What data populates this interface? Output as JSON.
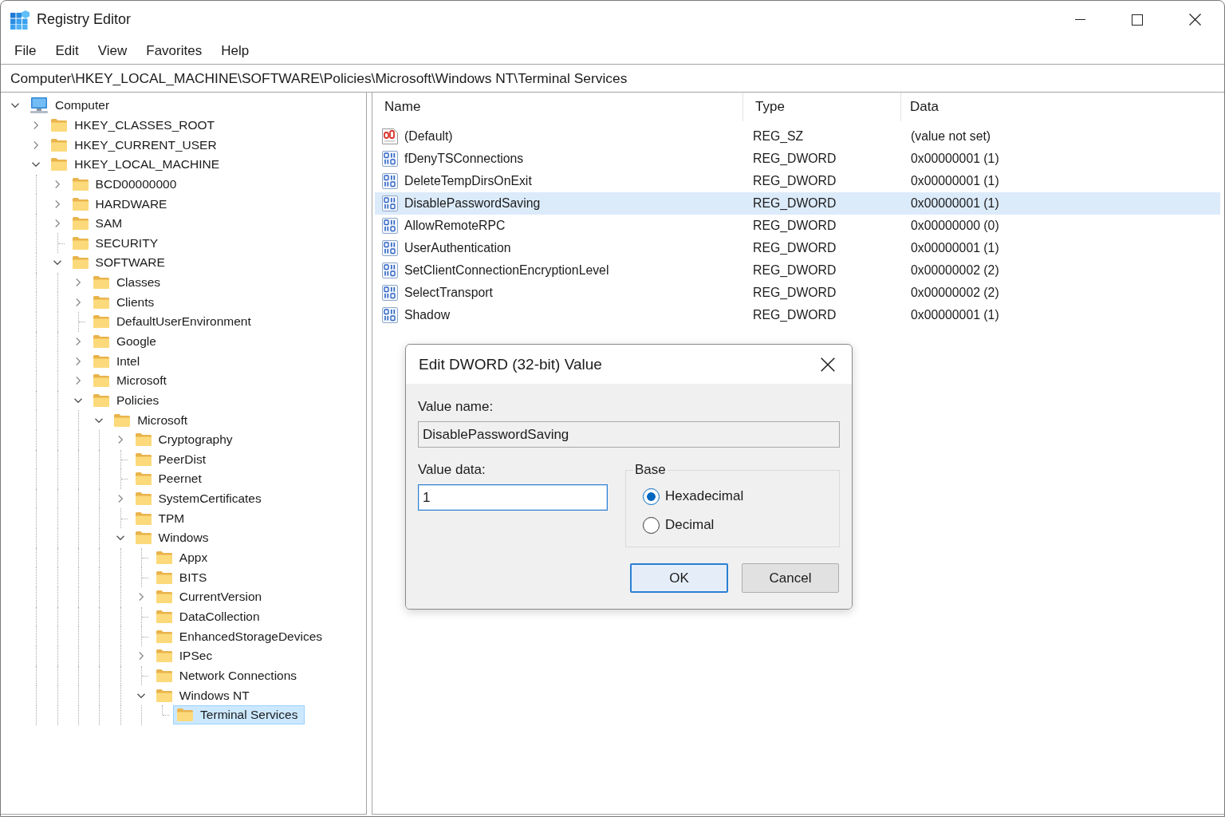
{
  "window": {
    "title": "Registry Editor"
  },
  "menu": [
    "File",
    "Edit",
    "View",
    "Favorites",
    "Help"
  ],
  "address_bar": {
    "value": "Computer\\HKEY_LOCAL_MACHINE\\SOFTWARE\\Policies\\Microsoft\\Windows NT\\Terminal Services"
  },
  "tree": [
    {
      "label": "Computer",
      "kind": "computer",
      "expanded": true,
      "selected": false,
      "children": [
        {
          "label": "HKEY_CLASSES_ROOT",
          "kind": "folder",
          "expanded": false,
          "selected": false
        },
        {
          "label": "HKEY_CURRENT_USER",
          "kind": "folder",
          "expanded": false,
          "selected": false
        },
        {
          "label": "HKEY_LOCAL_MACHINE",
          "kind": "folder",
          "expanded": true,
          "selected": false,
          "children": [
            {
              "label": "BCD00000000",
              "kind": "folder",
              "expanded": false,
              "selected": false
            },
            {
              "label": "HARDWARE",
              "kind": "folder",
              "expanded": false,
              "selected": false
            },
            {
              "label": "SAM",
              "kind": "folder",
              "expanded": false,
              "selected": false
            },
            {
              "label": "SECURITY",
              "kind": "folder",
              "selected": false
            },
            {
              "label": "SOFTWARE",
              "kind": "folder",
              "expanded": true,
              "selected": false,
              "children": [
                {
                  "label": "Classes",
                  "kind": "folder",
                  "expanded": false,
                  "selected": false
                },
                {
                  "label": "Clients",
                  "kind": "folder",
                  "expanded": false,
                  "selected": false
                },
                {
                  "label": "DefaultUserEnvironment",
                  "kind": "folder",
                  "selected": false
                },
                {
                  "label": "Google",
                  "kind": "folder",
                  "expanded": false,
                  "selected": false
                },
                {
                  "label": "Intel",
                  "kind": "folder",
                  "expanded": false,
                  "selected": false
                },
                {
                  "label": "Microsoft",
                  "kind": "folder",
                  "expanded": false,
                  "selected": false
                },
                {
                  "label": "Policies",
                  "kind": "folder",
                  "expanded": true,
                  "selected": false,
                  "children": [
                    {
                      "label": "Microsoft",
                      "kind": "folder",
                      "expanded": true,
                      "selected": false,
                      "children": [
                        {
                          "label": "Cryptography",
                          "kind": "folder",
                          "expanded": false,
                          "selected": false
                        },
                        {
                          "label": "PeerDist",
                          "kind": "folder",
                          "selected": false
                        },
                        {
                          "label": "Peernet",
                          "kind": "folder",
                          "selected": false
                        },
                        {
                          "label": "SystemCertificates",
                          "kind": "folder",
                          "expanded": false,
                          "selected": false
                        },
                        {
                          "label": "TPM",
                          "kind": "folder",
                          "selected": false
                        },
                        {
                          "label": "Windows",
                          "kind": "folder",
                          "expanded": true,
                          "selected": false,
                          "children": [
                            {
                              "label": "Appx",
                              "kind": "folder",
                              "selected": false
                            },
                            {
                              "label": "BITS",
                              "kind": "folder",
                              "selected": false
                            },
                            {
                              "label": "CurrentVersion",
                              "kind": "folder",
                              "expanded": false,
                              "selected": false
                            },
                            {
                              "label": "DataCollection",
                              "kind": "folder",
                              "selected": false
                            },
                            {
                              "label": "EnhancedStorageDevices",
                              "kind": "folder",
                              "selected": false
                            },
                            {
                              "label": "IPSec",
                              "kind": "folder",
                              "expanded": false,
                              "selected": false
                            },
                            {
                              "label": "Network Connections",
                              "kind": "folder",
                              "selected": false
                            },
                            {
                              "label": "Windows NT",
                              "kind": "folder",
                              "expanded": true,
                              "selected": false,
                              "children": [
                                {
                                  "label": "Terminal Services",
                                  "kind": "folder",
                                  "selected": true
                                }
                              ]
                            }
                          ]
                        }
                      ]
                    }
                  ]
                }
              ]
            }
          ]
        }
      ]
    }
  ],
  "values": {
    "columns": [
      "Name",
      "Type",
      "Data"
    ],
    "rows": [
      {
        "kind": "string",
        "name": "(Default)",
        "type": "REG_SZ",
        "data": "(value not set)",
        "selected": false
      },
      {
        "kind": "dword",
        "name": "fDenyTSConnections",
        "type": "REG_DWORD",
        "data": "0x00000001 (1)",
        "selected": false
      },
      {
        "kind": "dword",
        "name": "DeleteTempDirsOnExit",
        "type": "REG_DWORD",
        "data": "0x00000001 (1)",
        "selected": false
      },
      {
        "kind": "dword",
        "name": "DisablePasswordSaving",
        "type": "REG_DWORD",
        "data": "0x00000001 (1)",
        "selected": true
      },
      {
        "kind": "dword",
        "name": "AllowRemoteRPC",
        "type": "REG_DWORD",
        "data": "0x00000000 (0)",
        "selected": false
      },
      {
        "kind": "dword",
        "name": "UserAuthentication",
        "type": "REG_DWORD",
        "data": "0x00000001 (1)",
        "selected": false
      },
      {
        "kind": "dword",
        "name": "SetClientConnectionEncryptionLevel",
        "type": "REG_DWORD",
        "data": "0x00000002 (2)",
        "selected": false
      },
      {
        "kind": "dword",
        "name": "SelectTransport",
        "type": "REG_DWORD",
        "data": "0x00000002 (2)",
        "selected": false
      },
      {
        "kind": "dword",
        "name": "Shadow",
        "type": "REG_DWORD",
        "data": "0x00000001 (1)",
        "selected": false
      }
    ]
  },
  "dialog": {
    "title": "Edit DWORD (32-bit) Value",
    "value_name": {
      "label": "Value name:",
      "value": "DisablePasswordSaving",
      "read_only": true,
      "focused": false
    },
    "value_data": {
      "label": "Value data:",
      "value": "1",
      "read_only": false,
      "focused": true
    },
    "base_label": "Base",
    "bases": [
      {
        "label": "Hexadecimal",
        "selected": true
      },
      {
        "label": "Decimal",
        "selected": false
      }
    ],
    "buttons": [
      {
        "label": "OK",
        "default": true
      },
      {
        "label": "Cancel",
        "default": false
      }
    ]
  }
}
